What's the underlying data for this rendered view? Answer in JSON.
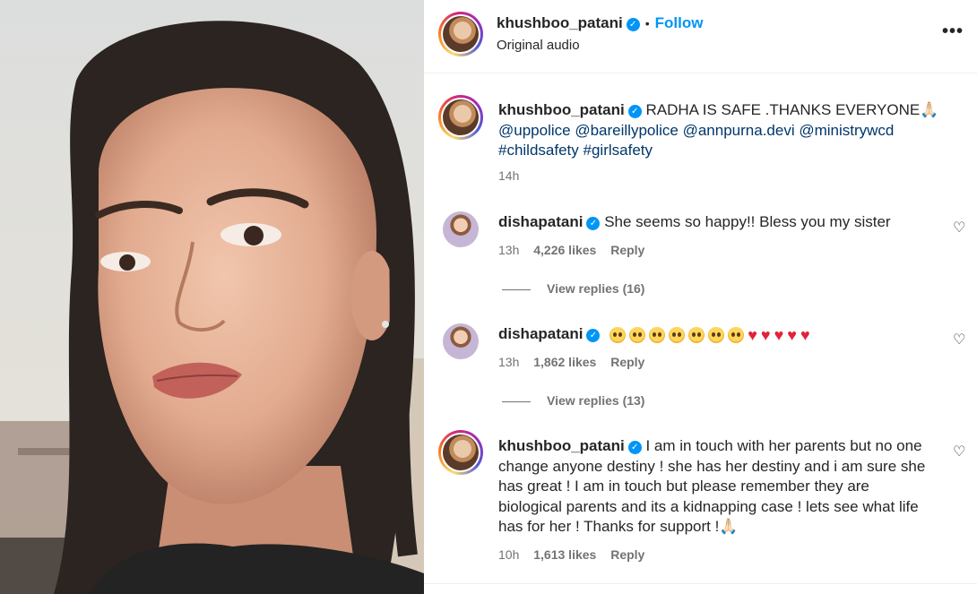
{
  "post": {
    "username": "khushboo_patani",
    "follow_label": "Follow",
    "separator": "•",
    "audio": "Original audio",
    "more_icon": "more-horizontal-icon",
    "more_glyph": "•••"
  },
  "caption": {
    "username": "khushboo_patani",
    "text": "RADHA IS SAFE .THANKS EVERYONE",
    "emoji": "🙏🏻",
    "mentions": [
      "@uppolice",
      "@bareillypolice",
      "@annpurna.devi",
      "@ministrywcd"
    ],
    "hashtags": [
      "#childsafety",
      "#girlsafety"
    ],
    "time": "14h"
  },
  "comments": [
    {
      "username": "dishapatani",
      "text": "She seems so happy!! Bless you my sister",
      "time": "13h",
      "likes": "4,226 likes",
      "reply": "Reply",
      "view_replies": "View replies (16)"
    },
    {
      "username": "dishapatani",
      "text": "",
      "emoji": "🥺🥺🥺🥺🥺🥺🥺❤️❤️❤️❤️❤️",
      "time": "13h",
      "likes": "1,862 likes",
      "reply": "Reply",
      "view_replies": "View replies (13)"
    },
    {
      "username": "khushboo_patani",
      "lines": [
        "I am in touch with her parents but no one",
        "change anyone destiny ! she has her destiny and i am sure she",
        "has great ! I am in touch but please remember they are",
        "biological parents and its a kidnapping case ! lets see what life",
        "has for her ! Thanks for support !"
      ],
      "emoji": "🙏🏻",
      "time": "10h",
      "likes": "1,613 likes",
      "reply": "Reply"
    }
  ],
  "colors": {
    "accent": "#0095f6",
    "mention": "#00376b",
    "secondary": "#737373",
    "heart": "#e0243b"
  }
}
